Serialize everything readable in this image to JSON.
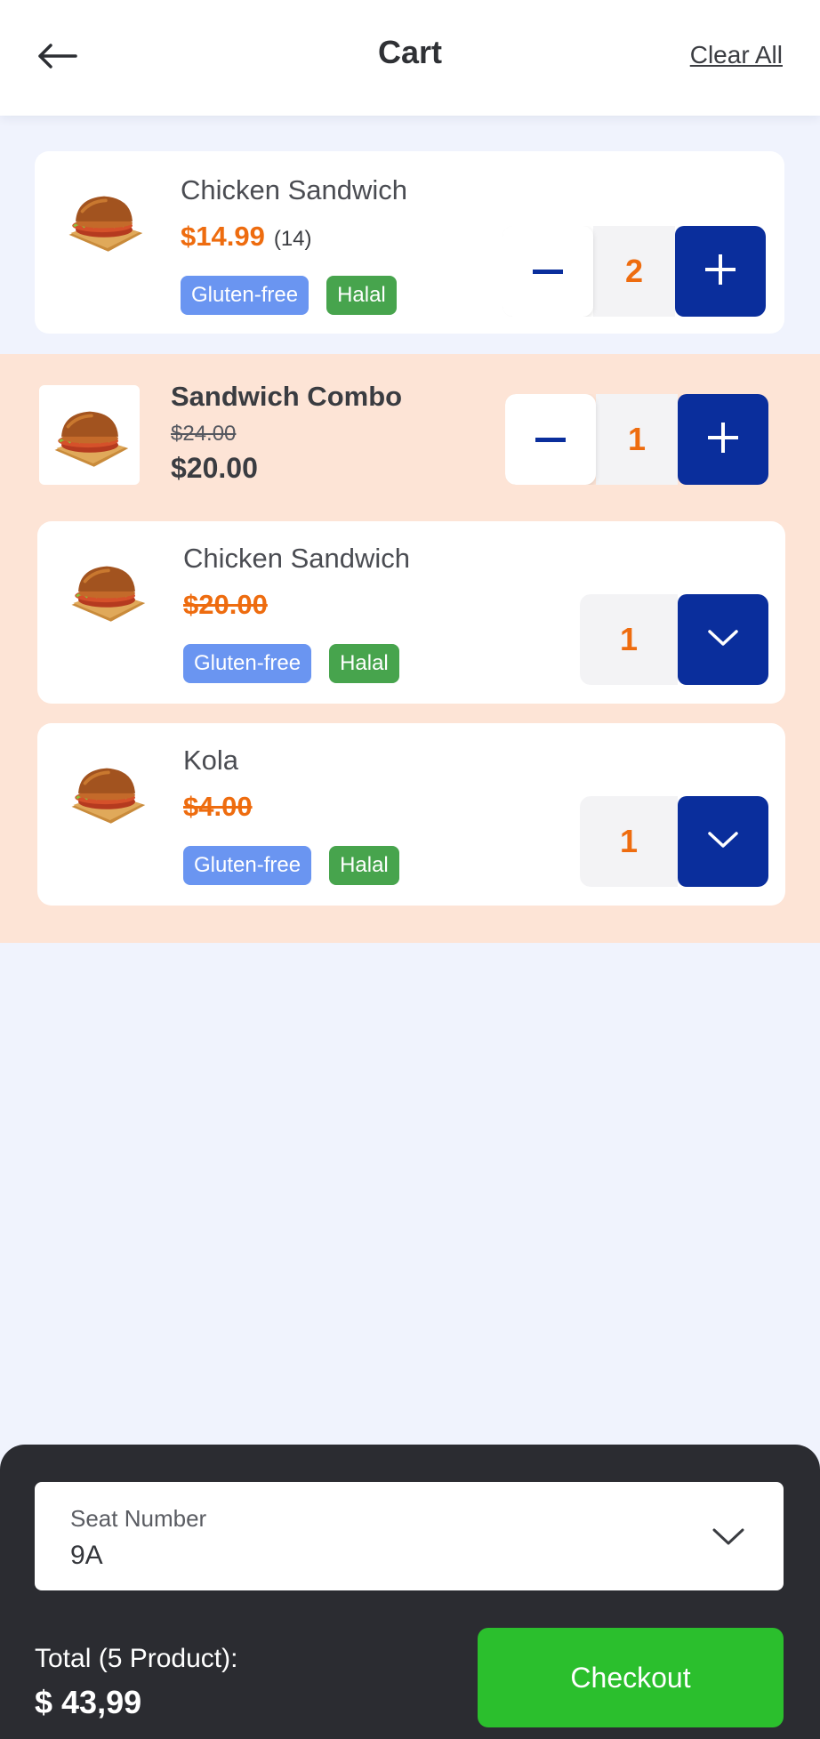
{
  "header": {
    "title": "Cart",
    "clear_all_label": "Clear All",
    "back_icon": "arrow-left-icon"
  },
  "cart": {
    "item1": {
      "name": "Chicken Sandwich",
      "price": "$14.99",
      "count": "(14)",
      "badges": [
        "Gluten-free",
        "Halal"
      ],
      "quantity": "2"
    },
    "combo": {
      "name": "Sandwich Combo",
      "old_price": "$24.00",
      "price": "$20.00",
      "quantity": "1",
      "items": [
        {
          "name": "Chicken Sandwich",
          "price": "$20.00",
          "badges": [
            "Gluten-free",
            "Halal"
          ],
          "quantity": "1"
        },
        {
          "name": "Kola",
          "price": "$4.00",
          "badges": [
            "Gluten-free",
            "Halal"
          ],
          "quantity": "1"
        }
      ]
    }
  },
  "footer": {
    "seat_label": "Seat Number",
    "seat_value": "9A",
    "total_label": "Total (5 Product):",
    "total_value": "$ 43,99",
    "checkout_label": "Checkout"
  },
  "colors": {
    "accent_blue": "#0a2e9c",
    "price_orange": "#ee6c0f",
    "checkout_green": "#2bbf2d",
    "gluten_free_badge": "#6a95f1",
    "halal_badge": "#47a44d",
    "combo_band": "#fde4d6",
    "bottom_panel": "#2b2c31"
  }
}
